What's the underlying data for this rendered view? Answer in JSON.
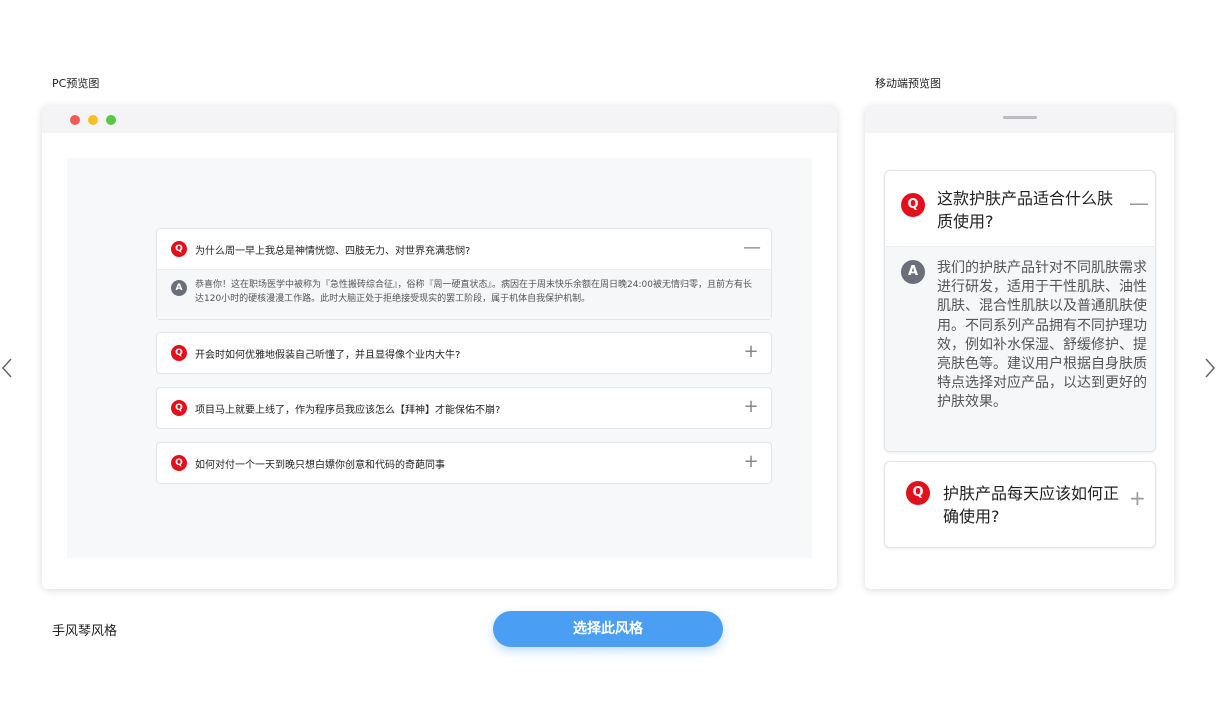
{
  "pc_label": "PC预览图",
  "mobile_label": "移动端预览图",
  "window_dots": {
    "red": "#f25a52",
    "yellow": "#f4c124",
    "green": "#55c93f"
  },
  "pc_faq": [
    {
      "badge": "Q",
      "question": "为什么周一早上我总是神情恍惚、四肢无力、对世界充满悲悯?",
      "toggle": "—",
      "expanded": true,
      "answer_badge": "A",
      "answer": "恭喜你！这在职场医学中被称为『急性搬砖综合征』，俗称『周一硬直状态』。病因在于周末快乐余额在周日晚24:00被无情归零，且前方有长达120小时的硬核漫漫工作路。此时大脑正处于拒绝接受现实的罢工阶段，属于机体自我保护机制。"
    },
    {
      "badge": "Q",
      "question": "开会时如何优雅地假装自己听懂了，并且显得像个业内大牛?",
      "toggle": "+",
      "expanded": false
    },
    {
      "badge": "Q",
      "question": "项目马上就要上线了，作为程序员我应该怎么【拜神】才能保佑不崩?",
      "toggle": "+",
      "expanded": false
    },
    {
      "badge": "Q",
      "question": "如何对付一个一天到晚只想白嫖你创意和代码的奇葩同事",
      "toggle": "+",
      "expanded": false
    }
  ],
  "mobile_faq": [
    {
      "badge": "Q",
      "question": "这款护肤产品适合什么肤质使用?",
      "toggle": "—",
      "expanded": true,
      "answer_badge": "A",
      "answer": "我们的护肤产品针对不同肌肤需求进行研发，适用于干性肌肤、油性肌肤、混合性肌肤以及普通肌肤使用。不同系列产品拥有不同护理功效，例如补水保湿、舒缓修护、提亮肤色等。建议用户根据自身肤质特点选择对应产品，以达到更好的护肤效果。"
    },
    {
      "badge": "Q",
      "question": "护肤产品每天应该如何正确使用?",
      "toggle": "+",
      "expanded": false
    }
  ],
  "style_name": "手风琴风格",
  "select_button": "选择此风格",
  "colors": {
    "q_badge": "#e3101c",
    "a_badge": "#6b6f79",
    "button": "#4a9ff5"
  }
}
